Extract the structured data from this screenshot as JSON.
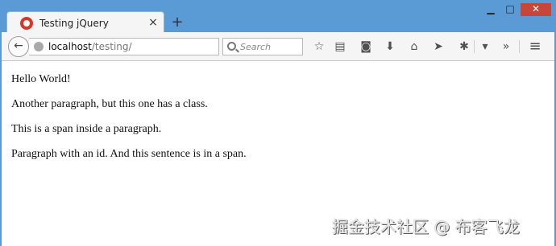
{
  "window": {
    "tab_title": "Testing jQuery",
    "tab_close": "×",
    "new_tab": "+",
    "minimize": "▁",
    "maximize": "□",
    "close": "✕"
  },
  "navbar": {
    "back_icon": "←",
    "url_host": "localhost",
    "url_path": "/testing/",
    "reload_icon": "↻",
    "search_placeholder": "Search",
    "icons": {
      "bookmark_star": "☆",
      "reading_list": "▤",
      "pocket": "◙",
      "download": "⬇",
      "home": "⌂",
      "send": "➤",
      "extension": "✱",
      "dropdown": "▾",
      "overflow": "»",
      "menu": "≡"
    }
  },
  "page": {
    "paragraphs": [
      "Hello World!",
      "Another paragraph, but this one has a class.",
      "This is a span inside a paragraph.",
      "Paragraph with an id. And this sentence is in a span."
    ]
  },
  "watermark": "掘金技术社区 @ 布客飞龙",
  "colors": {
    "titlebar": "#5b9bd5",
    "close_button": "#c7463a",
    "toolbar": "#f5f5f5"
  }
}
